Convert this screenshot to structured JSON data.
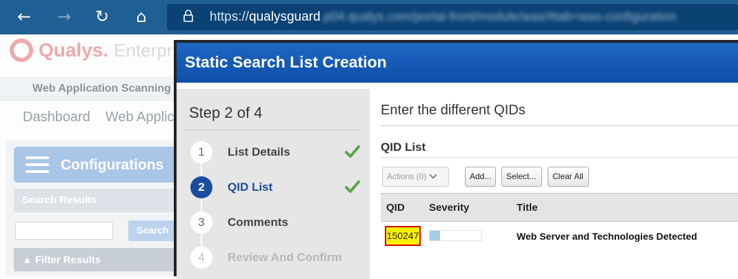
{
  "browser": {
    "url_prefix": "https://",
    "url_host": "qualysguard",
    "url_rest": ".p04.qualys.com/portal-front/module/was/#tab=was-configuration"
  },
  "background": {
    "logo_text": "Qualys.",
    "logo_sub": "Enterpris",
    "module": "Web Application Scanning",
    "nav": [
      "Dashboard",
      "Web Applic"
    ],
    "panel_title": "Configurations",
    "search_results": "Search Results",
    "search_button": "Search",
    "filter_results": "▲ Filter Results"
  },
  "modal": {
    "title": "Static Search List Creation",
    "step_heading": "Step 2 of 4",
    "steps": [
      {
        "num": "1",
        "label": "List Details",
        "state": "done"
      },
      {
        "num": "2",
        "label": "QID List",
        "state": "active"
      },
      {
        "num": "3",
        "label": "Comments",
        "state": "todo"
      },
      {
        "num": "4",
        "label": "Review And Confirm",
        "state": "disabled"
      }
    ],
    "content_title": "Enter the different QIDs",
    "section_title": "QID List",
    "toolbar": {
      "actions": "Actions (0)",
      "add": "Add...",
      "select": "Select...",
      "clear_all": "Clear All"
    },
    "columns": [
      "QID",
      "Severity",
      "Title"
    ],
    "rows": [
      {
        "qid": "150247",
        "severity_level": 1,
        "severity_max": 5,
        "title": "Web Server and Technologies Detected"
      }
    ]
  },
  "colors": {
    "browser_bar": "#1f5f93",
    "modal_title": "#1a5bb8",
    "active_step": "#1a4da0",
    "check": "#5aa34a",
    "highlight": "#fff200",
    "highlight_border": "#d40000"
  }
}
